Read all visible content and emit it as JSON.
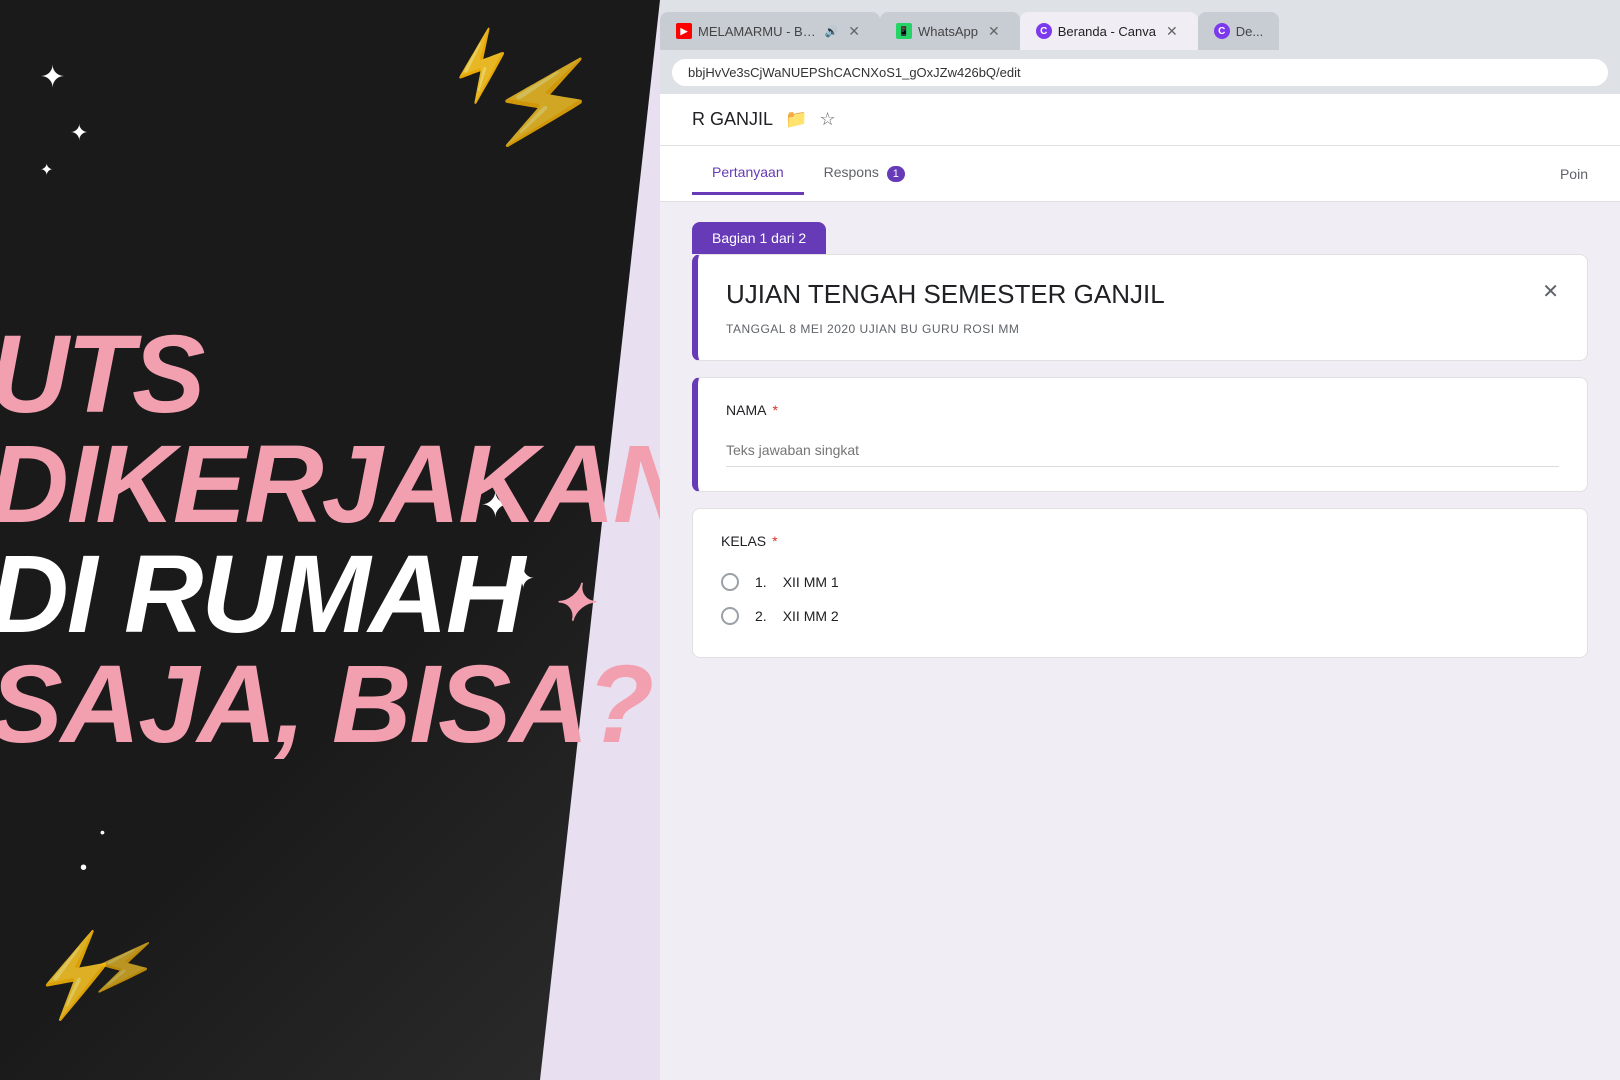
{
  "left_panel": {
    "lines": [
      {
        "text": "UTS",
        "color": "pink"
      },
      {
        "text": "DIKERJAKAN",
        "color": "pink"
      },
      {
        "text": "DI RUMAH",
        "color": "white"
      },
      {
        "text": "SAJA, BISA?",
        "color": "pink"
      }
    ]
  },
  "browser": {
    "tabs": [
      {
        "id": "yt",
        "label": "MELAMARMU - BA...",
        "favicon_type": "yt",
        "active": false,
        "closeable": true,
        "muted": true
      },
      {
        "id": "wa",
        "label": "WhatsApp",
        "favicon_type": "wa",
        "active": false,
        "closeable": true,
        "muted": false
      },
      {
        "id": "canva",
        "label": "Beranda - Canva",
        "favicon_type": "canva",
        "active": false,
        "closeable": true,
        "muted": false
      },
      {
        "id": "de",
        "label": "De...",
        "favicon_type": "de",
        "active": false,
        "closeable": false,
        "muted": false
      }
    ],
    "address_bar": {
      "url": "bbjHvVe3sCjWaNUEPShCACNXoS1_gOxJZw426bQ/edit"
    }
  },
  "forms": {
    "form_title_bar": {
      "title": "R GANJIL",
      "icons": [
        "folder",
        "star"
      ]
    },
    "tabs": {
      "pertanyaan": "Pertanyaan",
      "respons": "Respons",
      "respons_count": "1",
      "points": "Poin"
    },
    "section_label": "Bagian 1 dari 2",
    "title_card": {
      "title": "UJIAN TENGAH SEMESTER GANJIL",
      "subtitle": "TANGGAL 8 MEI 2020 UJIAN BU GURU ROSI MM"
    },
    "questions": [
      {
        "label": "NAMA",
        "required": true,
        "type": "short_text",
        "placeholder": "Teks jawaban singkat",
        "active": true
      },
      {
        "label": "KELAS",
        "required": true,
        "type": "radio",
        "options": [
          {
            "number": "1.",
            "text": "XII MM 1"
          },
          {
            "number": "2.",
            "text": "XII MM 2"
          }
        ],
        "active": false
      }
    ]
  }
}
